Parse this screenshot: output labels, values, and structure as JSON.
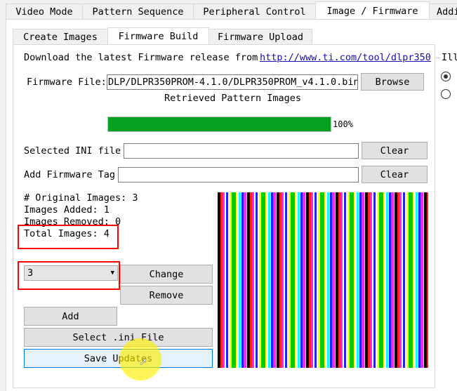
{
  "main_tabs": [
    {
      "label": "Video Mode"
    },
    {
      "label": "Pattern Sequence"
    },
    {
      "label": "Peripheral Control"
    },
    {
      "label": "Image / Firmware",
      "active": true
    },
    {
      "label": "Addi"
    }
  ],
  "sub_tabs": [
    {
      "label": "Create Images"
    },
    {
      "label": "Firmware Build",
      "active": true
    },
    {
      "label": "Firmware Upload"
    }
  ],
  "download_text": "Download the latest Firmware release from",
  "download_link": "http://www.ti.com/tool/dlpr350",
  "firmware_file_label": "Firmware File:",
  "firmware_file_value": "DLP/DLPR350PROM-4.1.0/DLPR350PROM_v4.1.0.bin",
  "browse_label": "Browse",
  "retrieved_label": "Retrieved Pattern Images",
  "progress": {
    "percent": 100,
    "label": "100%",
    "color": "#06a021"
  },
  "ini_label": "Selected INI file",
  "ini_value": "",
  "clear_label": "Clear",
  "tag_label": "Add Firmware Tag",
  "tag_value": "",
  "stats": {
    "original": "# Original Images: 3",
    "added": "Images Added: 1",
    "removed": "Images Removed: 0",
    "total": "Total Images: 4"
  },
  "image_select": "3",
  "change_label": "Change",
  "remove_label": "Remove",
  "add_label": "Add",
  "select_ini_label": "Select .ini File",
  "save_label": "Save Updates",
  "side_group_title": "Ill",
  "highlight_color": "#ff0000"
}
